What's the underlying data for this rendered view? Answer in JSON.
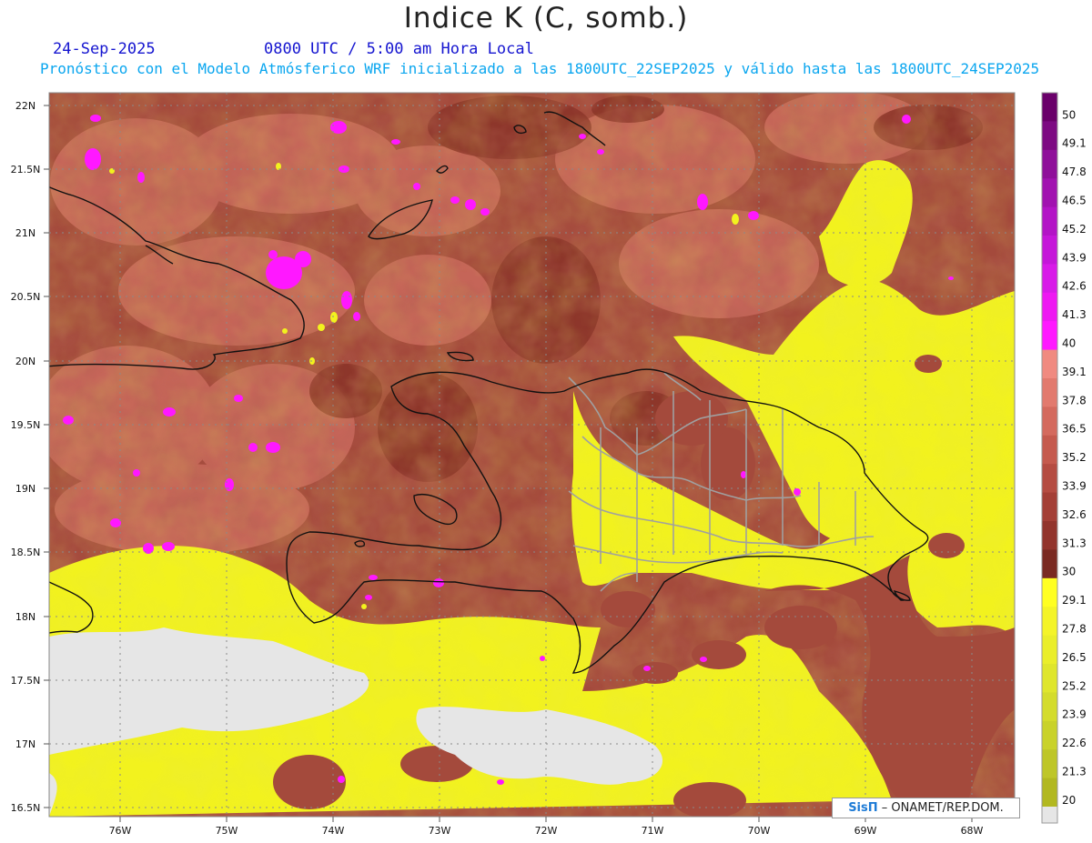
{
  "header": {
    "title": "Indice K (C, somb.)",
    "date": "24-Sep-2025",
    "valid_time": "0800 UTC / 5:00 am Hora Local",
    "description": "Pronóstico con el Modelo Atmósferico WRF inicializado a las 1800UTC_22SEP2025 y válido hasta las  1800UTC_24SEP2025"
  },
  "map": {
    "lat_labels": [
      "22N",
      "21.5N",
      "21N",
      "20.5N",
      "20N",
      "19.5N",
      "19N",
      "18.5N",
      "18N",
      "17.5N",
      "17N",
      "16.5N"
    ],
    "lon_labels": [
      "76W",
      "75W",
      "74W",
      "73W",
      "72W",
      "71W",
      "70W",
      "69W",
      "68W"
    ],
    "land_outline_color": "#111111",
    "province_outline_color": "#a0a0a0"
  },
  "colorbar": {
    "labels": [
      "50",
      "49.1",
      "47.8",
      "46.5",
      "45.2",
      "43.9",
      "42.6",
      "41.3",
      "40",
      "39.1",
      "37.8",
      "36.5",
      "35.2",
      "33.9",
      "32.6",
      "31.3",
      "30",
      "29.1",
      "27.8",
      "26.5",
      "25.2",
      "23.9",
      "22.6",
      "21.3",
      "20"
    ],
    "colors": [
      "#6a006a",
      "#7d0a82",
      "#8f0f9a",
      "#a112b0",
      "#b314c6",
      "#c516d9",
      "#d81ae8",
      "#ee18f2",
      "#ff18ff",
      "#f08a80",
      "#e27a6e",
      "#d46a5e",
      "#c55a4e",
      "#b54c42",
      "#a43f36",
      "#92342c",
      "#7a2a22",
      "#ffff22",
      "#f4f428",
      "#eaee2a",
      "#dfe62c",
      "#d4dc2c",
      "#c9d22a",
      "#bec628",
      "#b2b820"
    ],
    "missing_color": "#e6e6e6"
  },
  "credit": {
    "brand": "SisΠ",
    "text": "– ONAMET/REP.DOM."
  }
}
